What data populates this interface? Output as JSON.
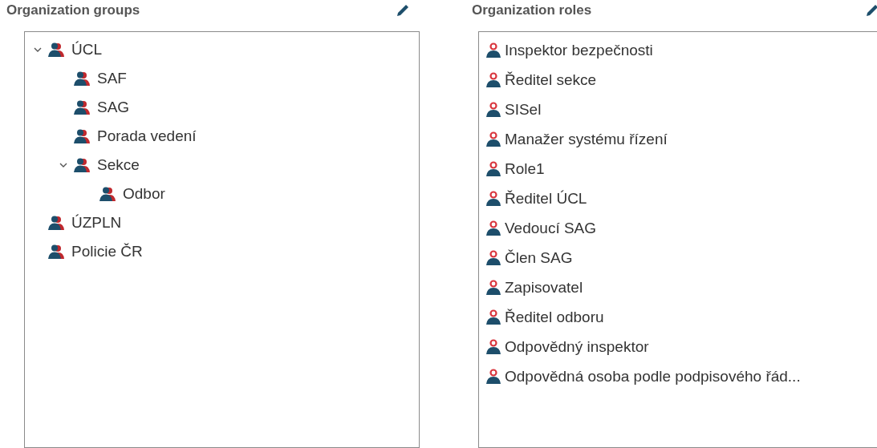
{
  "groups_panel": {
    "title": "Organization groups",
    "tree": [
      {
        "label": "ÚCL",
        "expanded": true,
        "children": [
          {
            "label": "SAF"
          },
          {
            "label": "SAG"
          },
          {
            "label": "Porada vedení"
          },
          {
            "label": "Sekce",
            "expanded": true,
            "children": [
              {
                "label": "Odbor"
              }
            ]
          }
        ]
      },
      {
        "label": "ÚZPLN"
      },
      {
        "label": "Policie ČR"
      }
    ]
  },
  "roles_panel": {
    "title": "Organization roles",
    "items": [
      "Inspektor bezpečnosti",
      "Ředitel sekce",
      "SISel",
      "Manažer systému řízení",
      "Role1",
      "Ředitel ÚCL",
      "Vedoucí SAG",
      "Člen SAG",
      "Zapisovatel",
      "Ředitel odboru",
      "Odpovědný inspektor",
      "Odpovědná osoba podle podpisového řád..."
    ]
  }
}
